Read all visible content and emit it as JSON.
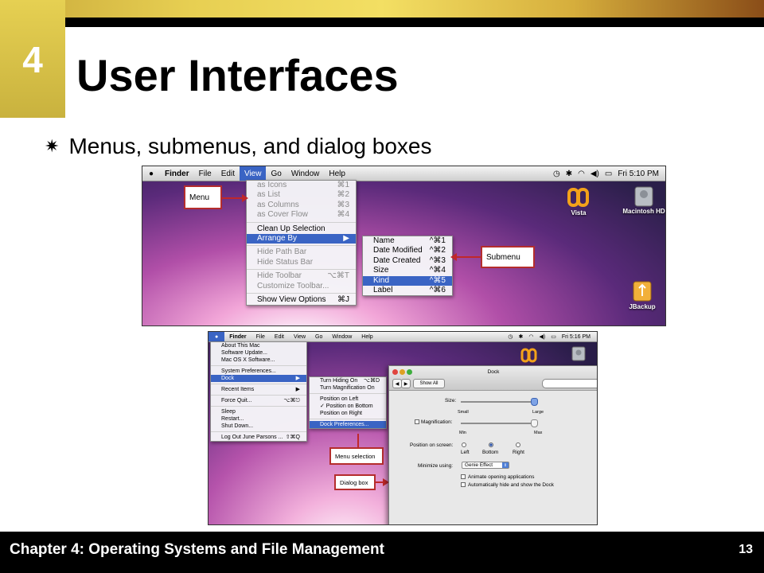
{
  "slide": {
    "chapter_number": "4",
    "title": "User Interfaces",
    "bullet": "Menus, submenus, and dialog boxes",
    "footer": "Chapter 4: Operating Systems and File Management",
    "page_number": "13"
  },
  "shot1": {
    "menubar": {
      "items": [
        "Finder",
        "File",
        "Edit",
        "View",
        "Go",
        "Window",
        "Help"
      ],
      "active": "View",
      "time": "Fri 5:10 PM"
    },
    "view_menu": [
      {
        "label": "as Icons",
        "shortcut": "⌘1",
        "dim": true
      },
      {
        "label": "as List",
        "shortcut": "⌘2",
        "dim": true
      },
      {
        "label": "as Columns",
        "shortcut": "⌘3",
        "dim": true
      },
      {
        "label": "as Cover Flow",
        "shortcut": "⌘4",
        "dim": true
      },
      {
        "sep": true
      },
      {
        "label": "Clean Up Selection",
        "shortcut": ""
      },
      {
        "label": "Arrange By",
        "shortcut": "▶",
        "selected": true
      },
      {
        "sep": true
      },
      {
        "label": "Hide Path Bar",
        "shortcut": "",
        "dim": true
      },
      {
        "label": "Hide Status Bar",
        "shortcut": "",
        "dim": true
      },
      {
        "sep": true
      },
      {
        "label": "Hide Toolbar",
        "shortcut": "⌥⌘T",
        "dim": true
      },
      {
        "label": "Customize Toolbar...",
        "shortcut": "",
        "dim": true
      },
      {
        "sep": true
      },
      {
        "label": "Show View Options",
        "shortcut": "⌘J"
      }
    ],
    "submenu": [
      {
        "label": "Name",
        "shortcut": "^⌘1"
      },
      {
        "label": "Date Modified",
        "shortcut": "^⌘2"
      },
      {
        "label": "Date Created",
        "shortcut": "^⌘3"
      },
      {
        "label": "Size",
        "shortcut": "^⌘4"
      },
      {
        "label": "Kind",
        "shortcut": "^⌘5",
        "selected": true
      },
      {
        "label": "Label",
        "shortcut": "^⌘6"
      }
    ],
    "callout_menu": "Menu",
    "callout_submenu": "Submenu",
    "desktop_icons": [
      "Vista",
      "Macintosh HD",
      "JBackup"
    ]
  },
  "shot2": {
    "menubar": {
      "items": [
        "Finder",
        "File",
        "Edit",
        "View",
        "Go",
        "Window",
        "Help"
      ],
      "time": "Fri 5:16 PM"
    },
    "apple_menu": [
      {
        "label": "About This Mac",
        "shortcut": ""
      },
      {
        "label": "Software Update...",
        "shortcut": ""
      },
      {
        "label": "Mac OS X Software...",
        "shortcut": ""
      },
      {
        "sep": true
      },
      {
        "label": "System Preferences...",
        "shortcut": ""
      },
      {
        "label": "Dock",
        "shortcut": "▶",
        "selected": true
      },
      {
        "sep": true
      },
      {
        "label": "Recent Items",
        "shortcut": "▶"
      },
      {
        "sep": true
      },
      {
        "label": "Force Quit...",
        "shortcut": "⌥⌘⎋"
      },
      {
        "sep": true
      },
      {
        "label": "Sleep",
        "shortcut": ""
      },
      {
        "label": "Restart...",
        "shortcut": ""
      },
      {
        "label": "Shut Down...",
        "shortcut": ""
      },
      {
        "sep": true
      },
      {
        "label": "Log Out June Parsons ...",
        "shortcut": "⇧⌘Q"
      }
    ],
    "dock_menu": [
      {
        "label": "Turn Hiding On",
        "shortcut": "⌥⌘D"
      },
      {
        "label": "Turn Magnification On",
        "shortcut": ""
      },
      {
        "sep": true
      },
      {
        "label": "Position on Left",
        "shortcut": ""
      },
      {
        "label": "✓ Position on Bottom",
        "shortcut": ""
      },
      {
        "label": "Position on Right",
        "shortcut": ""
      },
      {
        "sep": true
      },
      {
        "label": "Dock Preferences...",
        "shortcut": "",
        "selected": true
      }
    ],
    "callout_menu_selection": "Menu selection",
    "callout_dialog_box": "Dialog box",
    "dialog": {
      "title": "Dock",
      "show_all": "Show All",
      "size_label": "Size:",
      "size_small": "Small",
      "size_large": "Large",
      "size_value": 0.95,
      "magnification_label": "Magnification:",
      "mag_min": "Min",
      "mag_max": "Max",
      "mag_value": 0.95,
      "position_label": "Position on screen:",
      "positions": [
        "Left",
        "Bottom",
        "Right"
      ],
      "position_selected": "Bottom",
      "minimize_label": "Minimize using:",
      "minimize_value": "Genie Effect",
      "animate_label": "Animate opening applications",
      "autohide_label": "Automatically hide and show the Dock"
    },
    "desktop_icons": [
      "",
      ""
    ]
  }
}
